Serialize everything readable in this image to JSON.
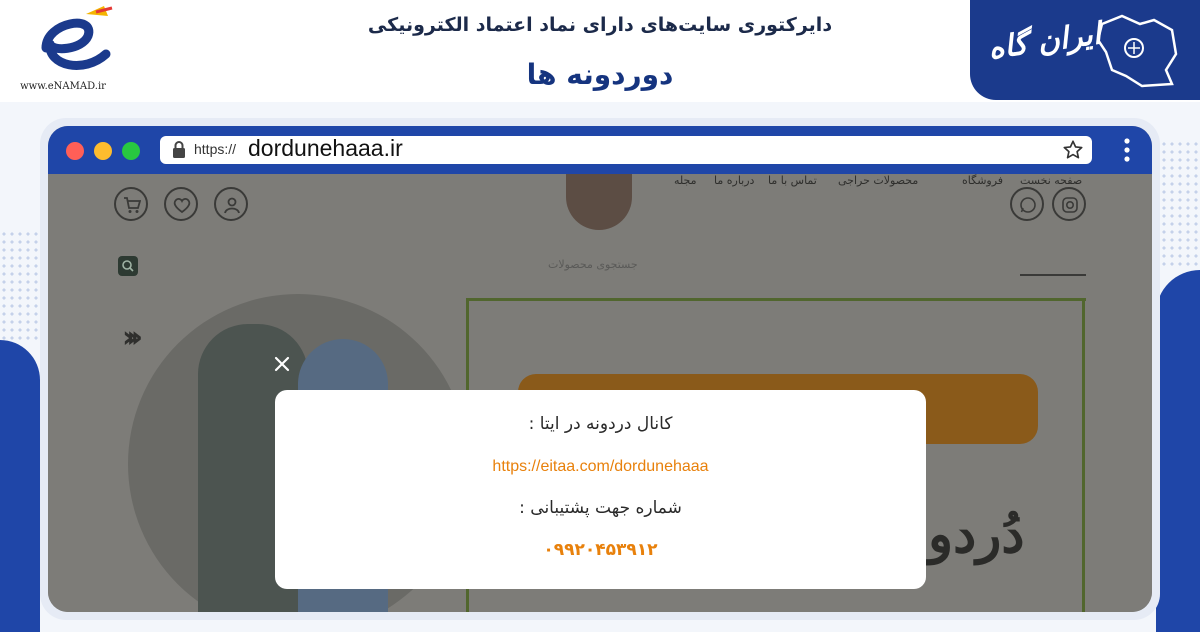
{
  "banner": {
    "enamad_url": "www.eNAMAD.ir",
    "subtitle": "دایرکتوری سایت‌های دارای نماد اعتماد الکترونیکی",
    "title": "دوردونه ها",
    "badge_text": "ایران گاه"
  },
  "browser": {
    "url_prefix": "https://",
    "url_domain": "dordunehaaa.ir"
  },
  "site_nav": {
    "items": [
      "صفحه نخست",
      "فروشگاه",
      "محصولات حراجی",
      "تماس با ما",
      "درباره ما",
      "مجله"
    ],
    "search_placeholder": "جستجوی محصولات"
  },
  "hero": {
    "script_text": "دُردو"
  },
  "modal": {
    "line1": "کانال دردونه در ایتا :",
    "line2": "https://eitaa.com/dordunehaaa",
    "line3": "شماره جهت پشتیبانی :",
    "line4": "۰۹۹۲۰۴۵۳۹۱۲"
  },
  "colors": {
    "brand_blue": "#1f46a8",
    "link_orange": "#e8810c"
  }
}
